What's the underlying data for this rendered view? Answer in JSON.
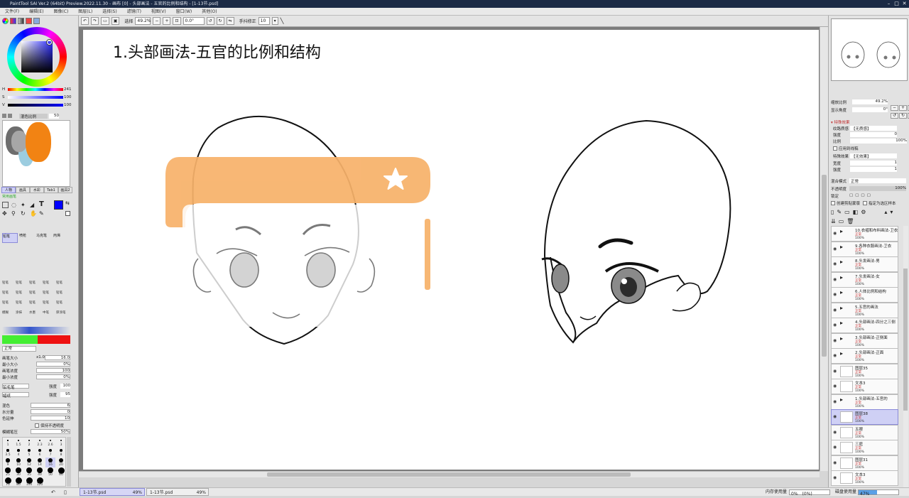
{
  "window": {
    "title": "PaintTool SAI Ver.2 (64bit) Preview.2022.11.30 - 画布 [0] - 头部画法 - 五官的比例和结构 - [1-13节.psd]"
  },
  "menubar": [
    "文件(F)",
    "编辑(E)",
    "图像(C)",
    "图层(L)",
    "选择(S)",
    "滤镜(T)",
    "视图(V)",
    "窗口(W)",
    "其他(O)"
  ],
  "toolbar": {
    "select_label": "选择",
    "zoom": "49.2%",
    "rotation": "0.0°",
    "stabilizer_label": "手抖修正",
    "stabilizer_value": "10"
  },
  "canvas": {
    "title": "1.头部画法-五官的比例和结构"
  },
  "color_sliders": [
    {
      "label": "H",
      "value": "241"
    },
    {
      "label": "S",
      "value": "100"
    },
    {
      "label": "V",
      "value": "100"
    }
  ],
  "scratch": {
    "opacity_label": "混色比例",
    "opacity_value": "50"
  },
  "tool_tabs": [
    "人物",
    "画具",
    "水彩",
    "Tab1",
    "画具2"
  ],
  "tool_tabs_sub": "常用画笔",
  "brushes_row1": [
    "铅笔",
    "喷枪",
    "马克笔",
    "丙烯"
  ],
  "brushes_small": [
    [
      "铅笔",
      "铅笔",
      "铅笔",
      "铅笔",
      "铅笔"
    ],
    [
      "铅笔",
      "铅笔",
      "铅笔",
      "铅笔",
      "铅笔"
    ],
    [
      "铅笔",
      "铅笔",
      "铅笔",
      "铅笔",
      "铅笔"
    ],
    [
      "模糊",
      "涂抹",
      "水墨",
      "中笔",
      "厚涂笔"
    ]
  ],
  "brush_settings": {
    "blend_mode": "正常",
    "size_label": "画笔大小",
    "size_mult": "x1.0",
    "size_value": "16.0",
    "min_size_label": "最小大小",
    "min_size_value": "0%",
    "density_label": "画笔浓度",
    "density_value": "100",
    "min_density_label": "最小浓度",
    "min_density_value": "0%",
    "shape_label": "铅毛笔",
    "shape_strength_label": "强度",
    "shape_strength_value": "100",
    "texture_label": "蜡纸",
    "texture_strength_label": "强度",
    "texture_strength_value": "95",
    "mix_label": "混色",
    "mix_value": "6",
    "water_label": "水分量",
    "water_value": "0",
    "keep_label": "色延伸",
    "keep_value": "10",
    "keep_opacity_label": "保持不透明度",
    "pressure_label": "模糊笔压",
    "pressure_value": "50%"
  },
  "brush_sizes": [
    "1",
    "1.5",
    "2",
    "2.3",
    "2.6",
    "3",
    "3.5",
    "4",
    "5",
    "6",
    "7",
    "8",
    "9",
    "10",
    "12",
    "14",
    "16",
    "20",
    "25",
    "30",
    "35",
    "40",
    "50",
    "60",
    "70",
    "80",
    "100",
    "120"
  ],
  "navigator": {
    "zoom_label": "缩放比例",
    "zoom_value": "49.2%",
    "angle_label": "显示角度",
    "angle_value": "0°"
  },
  "layer_props": {
    "effect_title": "特殊效果",
    "texture_label": "纹路质感",
    "texture_value": "【无质感】",
    "scale_label": "强度",
    "scale_value": "0",
    "ratio_label": "比例",
    "ratio_value": "100%",
    "apply_texture_label": "应用到线稿",
    "special_label": "特殊效果",
    "special_value": "【无效果】",
    "width_label": "宽度",
    "width_value": "1",
    "strength_label": "强度",
    "strength_value": "1",
    "blend_label": "混合模式",
    "blend_value": "正常",
    "opacity_label": "不透明度",
    "opacity_value": "100%",
    "protect_label": "锁定",
    "clip_label": "创建剪贴蒙版",
    "ref_label": "指定为选区样本"
  },
  "layers": [
    {
      "name": "10.衣褶和布料画法-卫衣",
      "mode": "正常",
      "opacity": "100%",
      "folder": true
    },
    {
      "name": "9.各种衣服画法-卫衣",
      "mode": "正常",
      "opacity": "100%",
      "folder": true
    },
    {
      "name": "8.头发画法-男",
      "mode": "正常",
      "opacity": "100%",
      "folder": true
    },
    {
      "name": "7.头发画法-女",
      "mode": "正常",
      "opacity": "100%",
      "folder": true
    },
    {
      "name": "6.人体比例和结构",
      "mode": "正常",
      "opacity": "100%",
      "folder": true
    },
    {
      "name": "5.五官的画法",
      "mode": "正常",
      "opacity": "100%",
      "folder": true
    },
    {
      "name": "4.头部画法-四分之三侧",
      "mode": "正常",
      "opacity": "100%",
      "folder": true
    },
    {
      "name": "3.头部画法-正侧面",
      "mode": "正常",
      "opacity": "100%",
      "folder": true
    },
    {
      "name": "2.头部画法-正面",
      "mode": "正常",
      "opacity": "100%",
      "folder": true
    },
    {
      "name": "图层35",
      "mode": "正常",
      "opacity": "100%",
      "folder": false
    },
    {
      "name": "文本3",
      "mode": "正常",
      "opacity": "100%",
      "folder": false
    },
    {
      "name": "1.头部画法-五官的",
      "mode": "正常",
      "opacity": "100%",
      "folder": true
    },
    {
      "name": "图层38",
      "mode": "正常",
      "opacity": "100%",
      "folder": false,
      "selected": true
    },
    {
      "name": "五眼",
      "mode": "正常",
      "opacity": "100%",
      "folder": false
    },
    {
      "name": "三庭",
      "mode": "正常",
      "opacity": "100%",
      "folder": false
    },
    {
      "name": "图层31",
      "mode": "正常",
      "opacity": "100%",
      "folder": false
    },
    {
      "name": "文本3",
      "mode": "正常",
      "opacity": "100%",
      "folder": false
    }
  ],
  "doc_tabs": [
    {
      "name": "1-13节.psd",
      "zoom": "49%"
    },
    {
      "name": "1-13节.psd",
      "zoom": "49%"
    }
  ],
  "status": {
    "memory_label": "内存使用量",
    "memory_value": "0%",
    "memory_value2": "(0%)",
    "disk_label": "磁盘使用量",
    "disk_value": "47%"
  },
  "colors": {
    "orange": "#f7b26a",
    "selected_layer": "#cfd0f5",
    "primary_color": "#0000ff",
    "titlebar": "#1b2a45"
  }
}
